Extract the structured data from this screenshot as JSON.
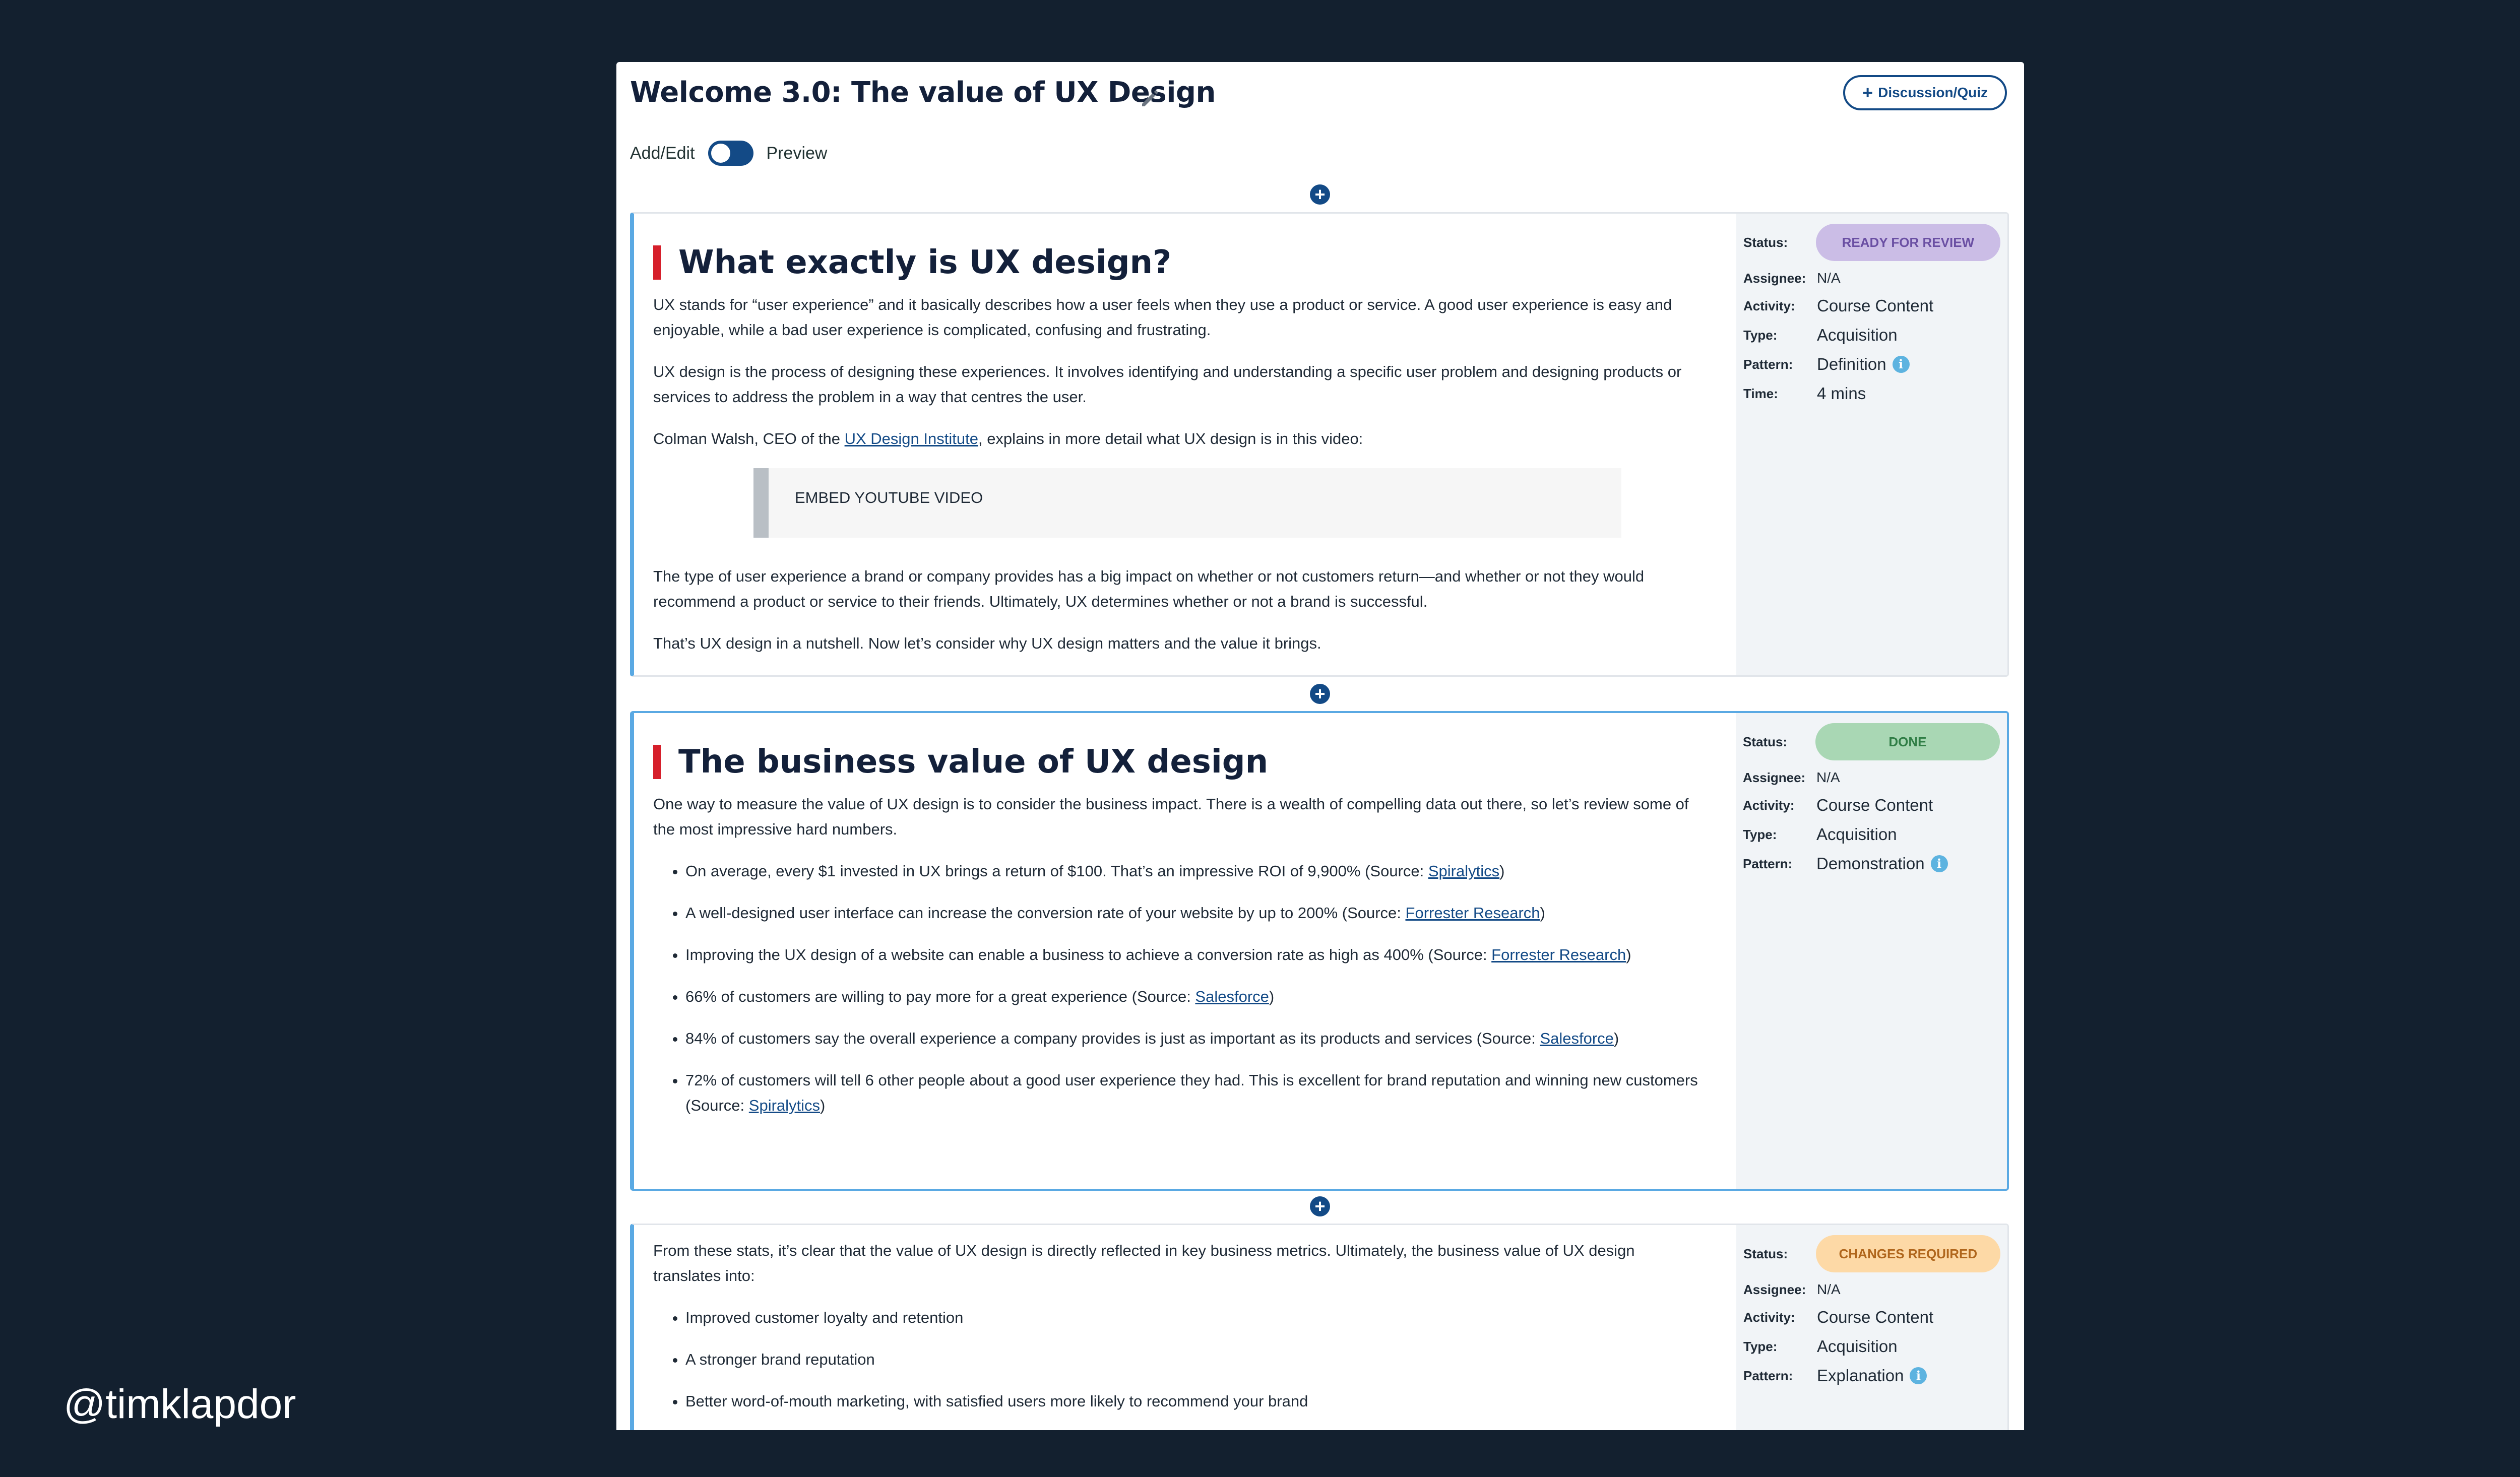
{
  "page": {
    "title": "Welcome 3.0: The value of UX Design",
    "discussion_button": "Discussion/Quiz",
    "toggle_left": "Add/Edit",
    "toggle_right": "Preview"
  },
  "labels": {
    "status": "Status:",
    "assignee": "Assignee:",
    "activity": "Activity:",
    "type": "Type:",
    "pattern": "Pattern:",
    "time": "Time:"
  },
  "blocks": [
    {
      "heading": "What exactly is UX design?",
      "p1": "UX stands for “user experience” and it basically describes how a user feels when they use a product or service. A good user experience is easy and enjoyable, while a bad user experience is complicated, confusing and frustrating.",
      "p2": "UX design is the process of designing these experiences. It involves identifying and understanding a specific user problem and designing products or services to address the problem in a way that centres the user.",
      "p3_before": "Colman Walsh, CEO of the ",
      "p3_link": "UX Design Institute",
      "p3_after": ", explains in more detail what UX design is in this video:",
      "embed": "EMBED YOUTUBE VIDEO",
      "p4": "The type of user experience a brand or company provides has a big impact on whether or not customers return—and whether or not they would recommend a product or service to their friends. Ultimately, UX determines whether or not a brand is successful.",
      "p5": "That’s UX design in a nutshell. Now let’s consider why UX design matters and the value it brings.",
      "meta": {
        "status": "READY FOR REVIEW",
        "status_bg": "#cbbde6",
        "status_fg": "#6a4fa3",
        "assignee": "N/A",
        "activity": "Course Content",
        "type": "Acquisition",
        "pattern": "Definition",
        "time": "4 mins"
      }
    },
    {
      "heading": "The business value of UX design",
      "p1": "One way to measure the value of UX design is to consider the business impact. There is a wealth of compelling data out there, so let’s review some of the most impressive hard numbers.",
      "bullets": [
        {
          "text": "On average, every $1 invested in UX brings a return of $100. That’s an impressive ROI of 9,900% (Source: ",
          "link": "Spiralytics",
          "after": ")"
        },
        {
          "text": "A well-designed user interface can increase the conversion rate of your website by up to 200% (Source: ",
          "link": "Forrester Research",
          "after": ")"
        },
        {
          "text": "Improving the UX design of a website can enable a business to achieve a conversion rate as high as 400% (Source: ",
          "link": "Forrester Research",
          "after": ")"
        },
        {
          "text": "66% of customers are willing to pay more for a great experience (Source: ",
          "link": "Salesforce",
          "after": ")"
        },
        {
          "text": "84% of customers say the overall experience a company provides is just as important as its products and services (Source: ",
          "link": "Salesforce",
          "after": ")"
        },
        {
          "text": "72% of customers will tell 6 other people about a good user experience they had. This is excellent for brand reputation and winning new customers (Source: ",
          "link": "Spiralytics",
          "after": ")"
        }
      ],
      "meta": {
        "status": "DONE",
        "status_bg": "#a9d7b4",
        "status_fg": "#2f7d45",
        "assignee": "N/A",
        "activity": "Course Content",
        "type": "Acquisition",
        "pattern": "Demonstration"
      }
    },
    {
      "p1": "From these stats, it’s clear that the value of UX design is directly reflected in key business metrics. Ultimately, the business value of UX design translates into:",
      "bullets": [
        "Improved customer loyalty and retention",
        "A stronger brand reputation",
        "Better word-of-mouth marketing, with satisfied users more likely to recommend your brand"
      ],
      "meta": {
        "status": "CHANGES REQUIRED",
        "status_bg": "#fdd9a6",
        "status_fg": "#b0661c",
        "assignee": "N/A",
        "activity": "Course Content",
        "type": "Acquisition",
        "pattern": "Explanation"
      }
    }
  ],
  "watermark": "@timklapdor"
}
